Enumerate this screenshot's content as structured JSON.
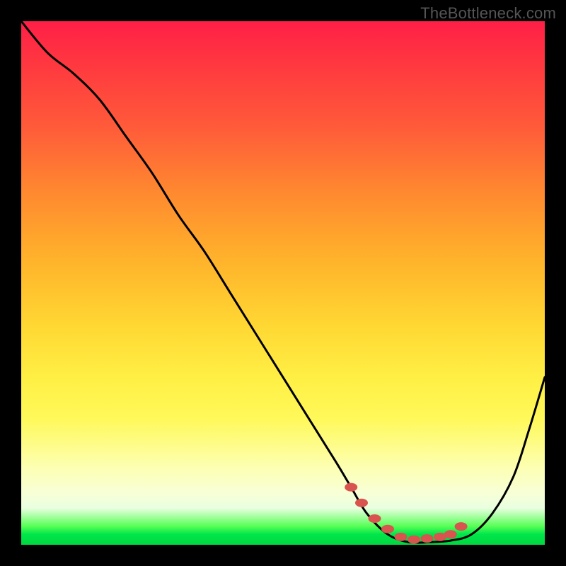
{
  "attribution": "TheBottleneck.com",
  "colors": {
    "page_bg": "#000000",
    "gradient_top": "#ff1f47",
    "gradient_bottom": "#00d840",
    "curve": "#000000",
    "marker": "#d9534f"
  },
  "chart_data": {
    "type": "line",
    "title": "",
    "xlabel": "",
    "ylabel": "",
    "xlim": [
      0,
      100
    ],
    "ylim": [
      0,
      100
    ],
    "series": [
      {
        "name": "bottleneck-curve",
        "x": [
          0,
          5,
          10,
          15,
          20,
          25,
          30,
          35,
          40,
          45,
          50,
          55,
          60,
          63,
          66,
          70,
          74,
          78,
          82,
          86,
          90,
          94,
          97,
          100
        ],
        "y": [
          100,
          94,
          90,
          85,
          78,
          71,
          63,
          56,
          48,
          40,
          32,
          24,
          16,
          11,
          6,
          2,
          0.5,
          0.5,
          0.8,
          2,
          6,
          13,
          22,
          32
        ]
      }
    ],
    "markers": {
      "name": "optimal-range",
      "x": [
        63,
        65,
        67.5,
        70,
        72.5,
        75,
        77.5,
        80,
        82,
        84
      ],
      "y": [
        11,
        8,
        5,
        3,
        1.5,
        1,
        1.2,
        1.5,
        2,
        3.5
      ]
    }
  }
}
